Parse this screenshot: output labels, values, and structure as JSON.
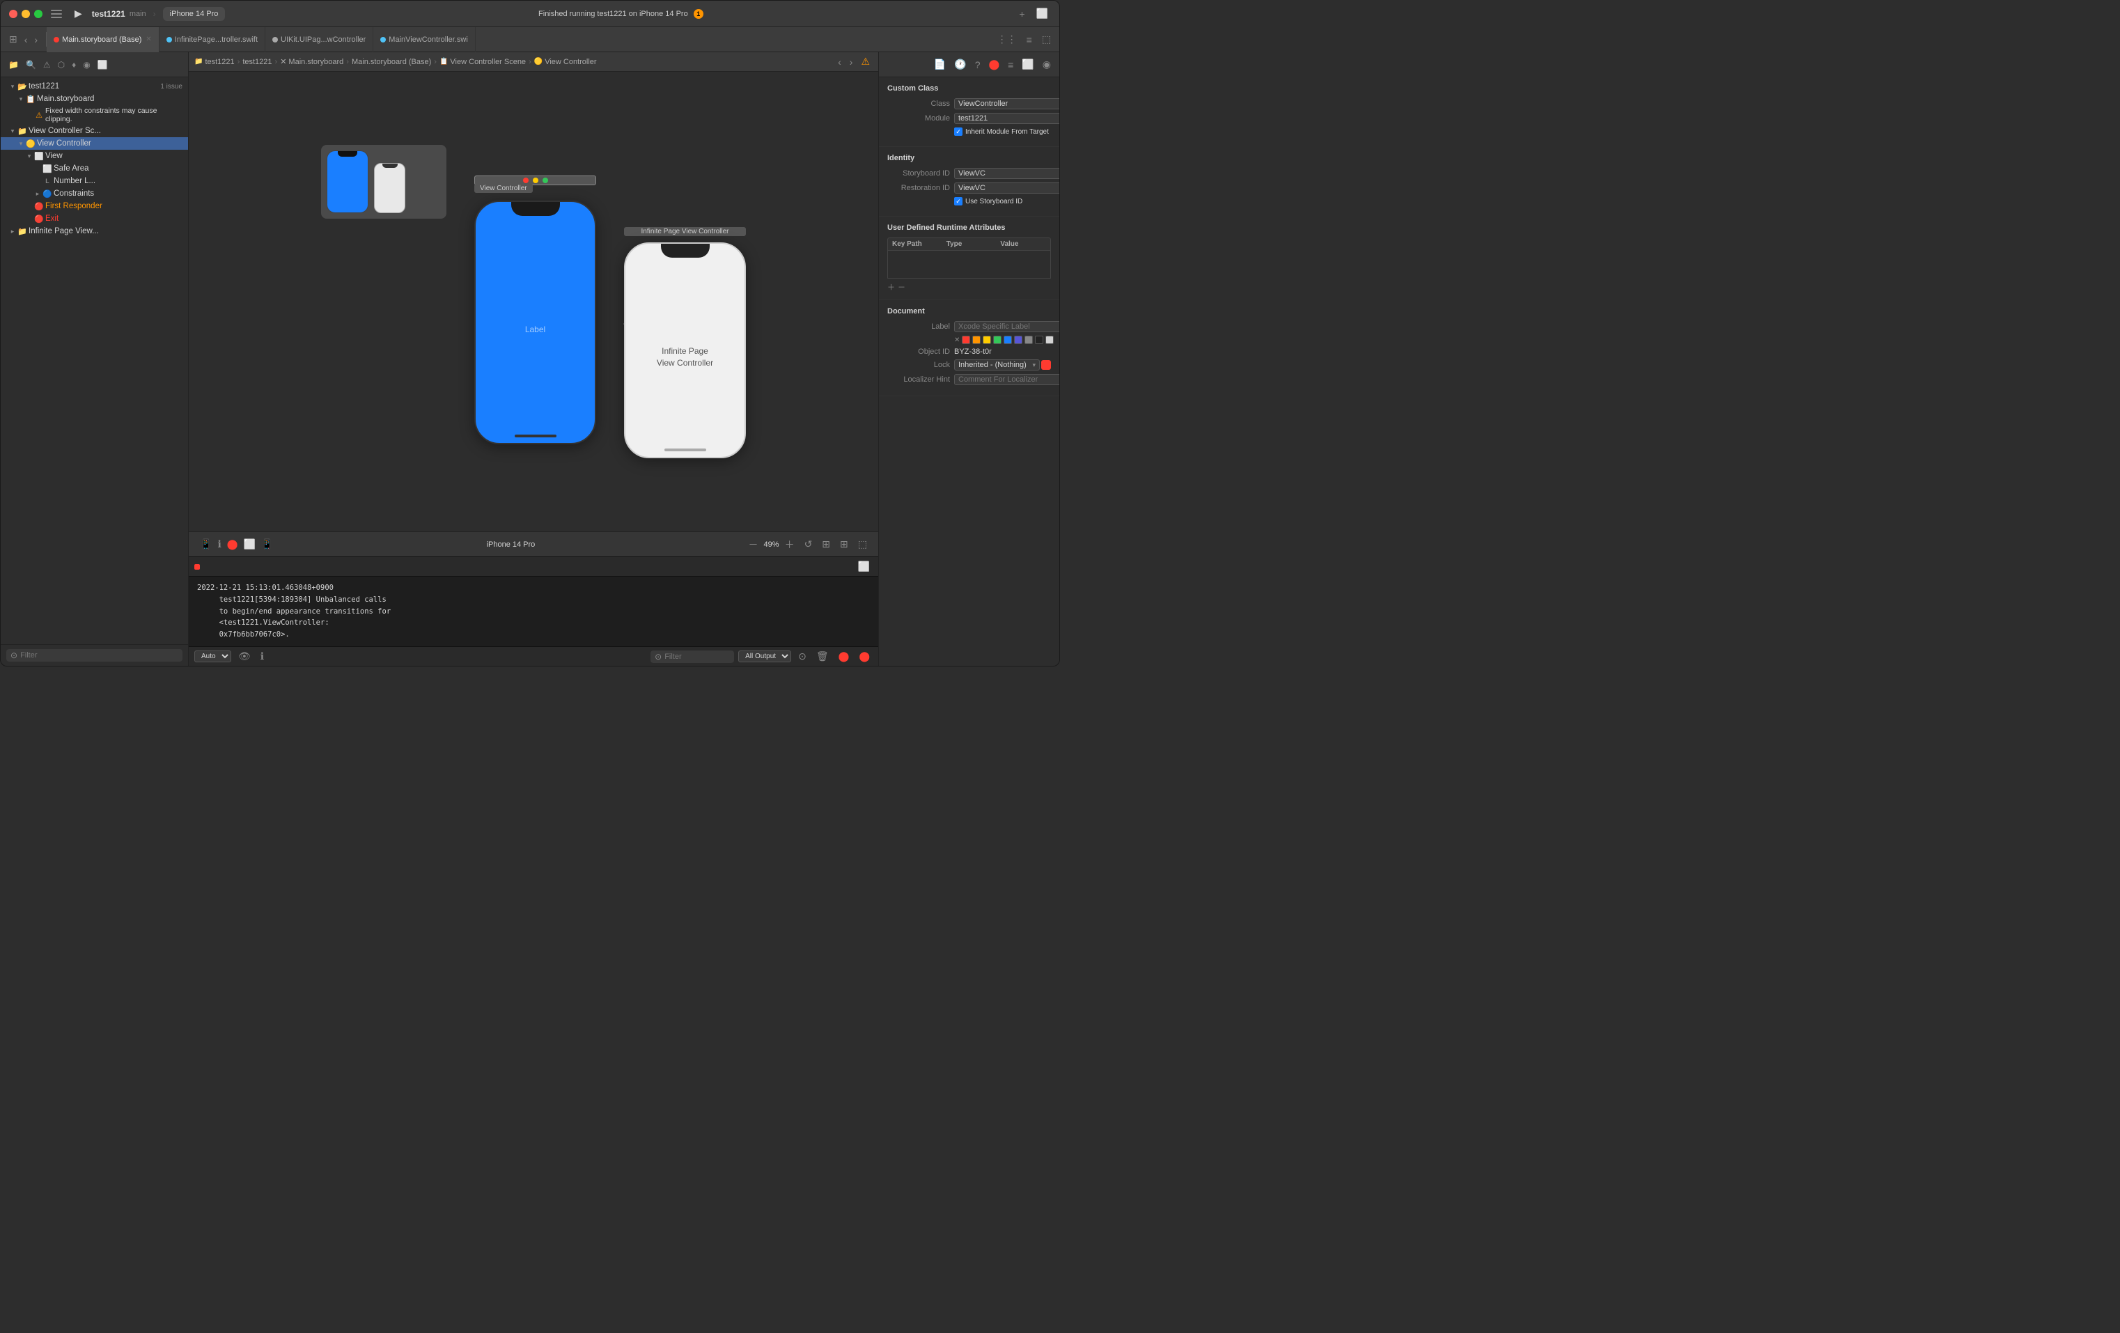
{
  "window": {
    "title": "test1221 — main",
    "project": "test1221",
    "branch": "main",
    "device": "iPhone 14 Pro",
    "status": "Finished running test1221 on iPhone 14 Pro",
    "warning_count": "1"
  },
  "titlebar": {
    "play_btn": "▶",
    "add_btn": "+",
    "layout_btn": "⬜"
  },
  "tabs": [
    {
      "id": "storyboard",
      "label": "Main.storyboard (Base)",
      "icon_color": "#ff3b30",
      "active": true
    },
    {
      "id": "infinite",
      "label": "InfinitePage...troller.swift",
      "icon_color": "#4fc3f7",
      "active": false
    },
    {
      "id": "uikit",
      "label": "UIKit.UIPag...wController",
      "icon_color": "#aaa",
      "active": false
    },
    {
      "id": "mainvc",
      "label": "MainViewController.swi",
      "icon_color": "#4fc3f7",
      "active": false
    }
  ],
  "breadcrumb": {
    "items": [
      "test1221",
      "test1221",
      "Main.storyboard",
      "Main.storyboard (Base)",
      "View Controller Scene",
      "View Controller"
    ]
  },
  "left_sidebar": {
    "project_item": "test1221",
    "project_issue": "1 issue",
    "storyboard": "Main.storyboard",
    "warning_text": "Fixed width constraints may cause clipping.",
    "tree": [
      {
        "label": "View Controller Sc...",
        "indent": 1,
        "expanded": true,
        "icon": "📋"
      },
      {
        "label": "View Controller",
        "indent": 2,
        "expanded": true,
        "icon": "🟡",
        "selected": true
      },
      {
        "label": "View",
        "indent": 3,
        "expanded": true,
        "icon": "⬜"
      },
      {
        "label": "Safe Area",
        "indent": 4,
        "expanded": false,
        "icon": "⬜"
      },
      {
        "label": "L  Number L...",
        "indent": 4,
        "expanded": false,
        "icon": "L"
      },
      {
        "label": "Constraints",
        "indent": 4,
        "expanded": false,
        "icon": "🔵"
      },
      {
        "label": "First Responder",
        "indent": 3,
        "expanded": false,
        "icon": "🔴"
      },
      {
        "label": "Exit",
        "indent": 3,
        "expanded": false,
        "icon": "🔴"
      },
      {
        "label": "Infinite Page View...",
        "indent": 1,
        "expanded": false,
        "icon": "📋"
      }
    ]
  },
  "canvas": {
    "device_label": "iPhone 14 Pro",
    "zoom_level": "49%",
    "phone_label": "Label",
    "scene_label": "View Controller",
    "infinite_page_label": "Infinite Page\nView Controller",
    "infinite_scene_label": "Infinite Page View Controller"
  },
  "right_panel": {
    "custom_class": {
      "title": "Custom Class",
      "class_label": "Class",
      "class_value": "ViewController",
      "module_label": "Module",
      "module_value": "test1221",
      "inherit_label": "Inherit Module From Target"
    },
    "identity": {
      "title": "Identity",
      "storyboard_id_label": "Storyboard ID",
      "storyboard_id_value": "ViewVC",
      "restoration_id_label": "Restoration ID",
      "restoration_id_value": "ViewVC",
      "use_storyboard_id_label": "Use Storyboard ID"
    },
    "runtime_attrs": {
      "title": "User Defined Runtime Attributes",
      "col_key_path": "Key Path",
      "col_type": "Type",
      "col_value": "Value"
    },
    "document": {
      "title": "Document",
      "label_label": "Label",
      "label_value": "Xcode Specific Label",
      "object_id_label": "Object ID",
      "object_id_value": "BYZ-38-t0r",
      "lock_label": "Lock",
      "lock_value": "Inherited - (Nothing)",
      "localizer_hint_label": "Localizer Hint",
      "localizer_hint_placeholder": "Comment For Localizer"
    }
  },
  "log": {
    "content": "2022-12-21 15:13:01.463048+0900\n     test1221[5394:189304] Unbalanced calls\n     to begin/end appearance transitions for\n     <test1221.ViewController:\n     0x7fb6bb7067c0>.",
    "output_label": "All Output",
    "auto_label": "Auto"
  },
  "colors": {
    "accent_blue": "#1a7fff",
    "bg_dark": "#2d2d2d",
    "bg_medium": "#3c3c3c",
    "border": "#333333",
    "warning": "#ff9500",
    "red": "#ff3b30",
    "text_primary": "#d4d4d4",
    "text_secondary": "#888888"
  }
}
